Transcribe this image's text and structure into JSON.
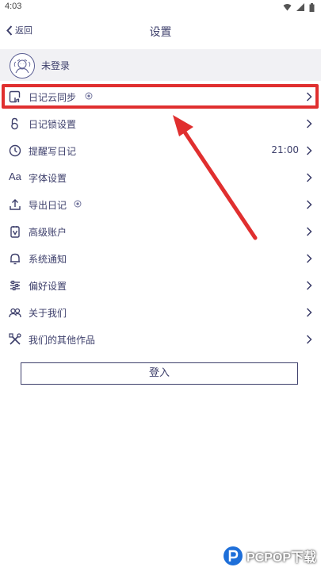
{
  "status_bar": {
    "time": "4:03"
  },
  "header": {
    "back_label": "返回",
    "title": "设置"
  },
  "profile": {
    "name": "未登录"
  },
  "menu": {
    "items": [
      {
        "label": "日记云同步",
        "icon": "cloud-sync-icon",
        "value": ""
      },
      {
        "label": "日记锁设置",
        "icon": "lock-icon",
        "value": ""
      },
      {
        "label": "提醒写日记",
        "icon": "clock-icon",
        "value": "21:00"
      },
      {
        "label": "字体设置",
        "icon": "font-icon",
        "value": ""
      },
      {
        "label": "导出日记",
        "icon": "export-icon",
        "value": ""
      },
      {
        "label": "高级账户",
        "icon": "premium-account-icon",
        "value": ""
      },
      {
        "label": "系统通知",
        "icon": "bell-icon",
        "value": ""
      },
      {
        "label": "偏好设置",
        "icon": "sliders-icon",
        "value": ""
      },
      {
        "label": "关于我们",
        "icon": "team-icon",
        "value": ""
      },
      {
        "label": "我们的其他作品",
        "icon": "tools-icon",
        "value": ""
      }
    ]
  },
  "login_button": {
    "label": "登入"
  },
  "watermark": {
    "text": "PCPOP下载"
  },
  "colors": {
    "text": "#3d3f6b",
    "highlight": "#e02f2f",
    "profile_bg": "#f1f1f4"
  }
}
